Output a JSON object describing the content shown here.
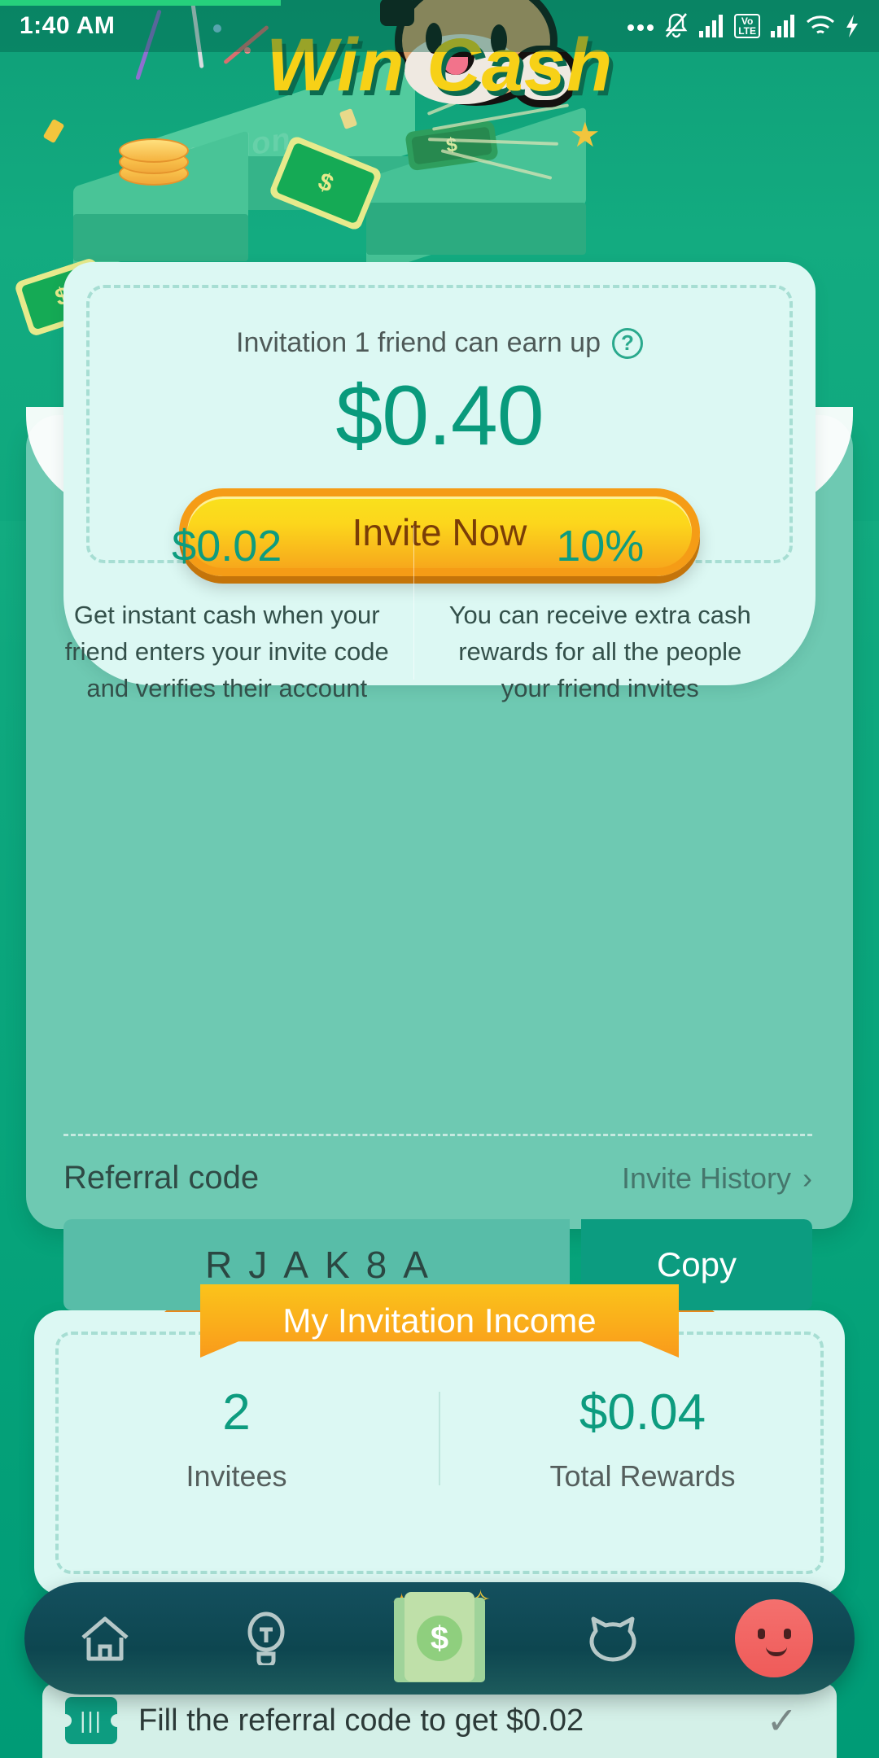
{
  "status_bar": {
    "time": "1:40 AM",
    "icons": [
      "dots-icon",
      "silent-bell-icon",
      "signal-bars-icon",
      "volte-icon",
      "signal-bars-2-icon",
      "wifi-icon",
      "charging-bolt-icon"
    ],
    "volte_label_top": "Vo",
    "volte_label_bottom": "LTE"
  },
  "header": {
    "title": "Win Cash",
    "brandmark": "readon"
  },
  "invite_card": {
    "subtitle": "Invitation 1 friend can earn up",
    "help_icon_label": "?",
    "amount": "$0.40",
    "cta_label": "Invite Now"
  },
  "benefits": [
    {
      "amount": "$0.02",
      "description": "Get instant cash when your friend enters your invite code and verifies their account"
    },
    {
      "amount": "10%",
      "description": "You can receive extra cash rewards for all the people your friend invites"
    }
  ],
  "referral": {
    "label": "Referral code",
    "history_label": "Invite History",
    "history_chevron": "›",
    "code": "RJAK8A",
    "copy_label": "Copy"
  },
  "income": {
    "ribbon_title": "My Invitation Income",
    "stats": [
      {
        "value": "2",
        "label": "Invitees"
      },
      {
        "value": "$0.04",
        "label": "Total Rewards"
      }
    ]
  },
  "bottom_nav": {
    "items": [
      {
        "name": "home",
        "icon": "home-icon"
      },
      {
        "name": "discover",
        "icon": "lightbulb-icon"
      },
      {
        "name": "cash",
        "icon": "cash-bill-icon",
        "active": true
      },
      {
        "name": "cat",
        "icon": "cat-face-icon"
      },
      {
        "name": "profile",
        "icon": "avatar-icon"
      }
    ],
    "cash_symbol": "$"
  },
  "toast": {
    "icon": "ticket-icon",
    "message": "Fill the referral code to get $0.02",
    "check": "✓"
  },
  "colors": {
    "brand_green": "#0fa87e",
    "deep_green": "#0d9c80",
    "envelope": "#6ec9b2",
    "card_mint": "#dcf8f3",
    "gold": "#f7d117",
    "button_orange": "#f59c16",
    "nav_dark": "#0d4650"
  }
}
